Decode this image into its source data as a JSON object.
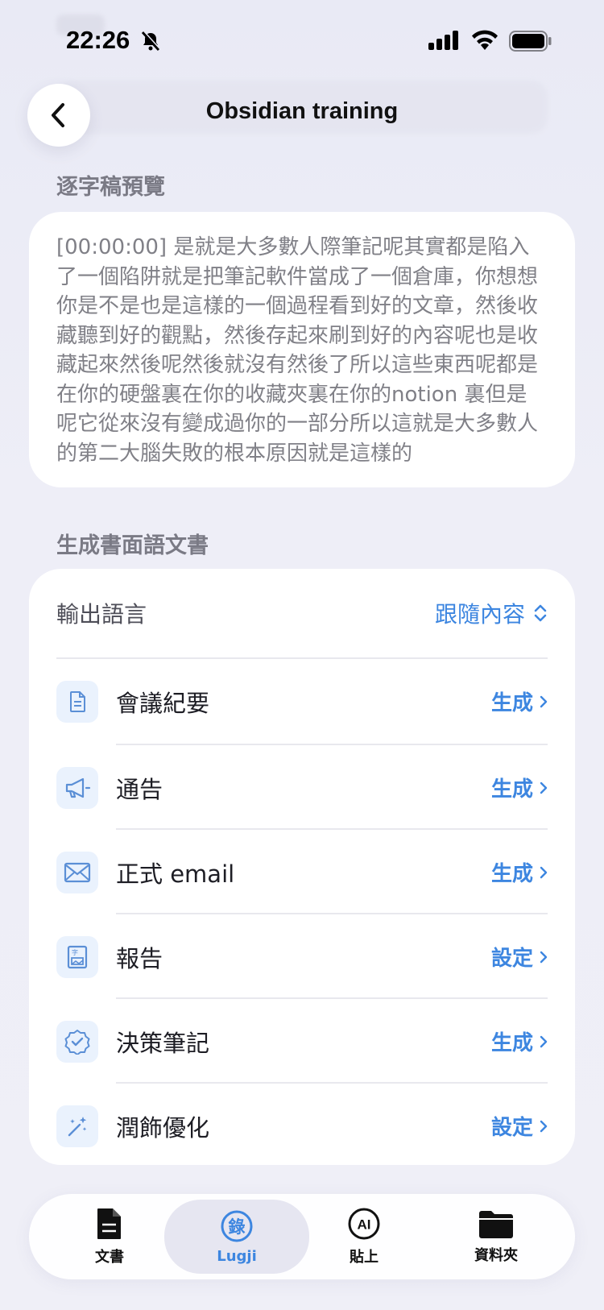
{
  "status": {
    "time": "22:26"
  },
  "nav": {
    "title": "Obsidian training"
  },
  "transcript": {
    "section_label": "逐字稿預覽",
    "text": "[00:00:00] 是就是大多數人際筆記呢其實都是陷入了一個陷阱就是把筆記軟件當成了一個倉庫，你想想你是不是也是這樣的一個過程看到好的文章，然後收藏聽到好的觀點，然後存起來刷到好的內容呢也是收藏起來然後呢然後就沒有然後了所以這些東西呢都是在你的硬盤裏在你的收藏夾裏在你的notion 裏但是呢它從來沒有變成過你的一部分所以這就是大多數人的第二大腦失敗的根本原因就是這樣的"
  },
  "documents": {
    "section_label": "生成書面語文書",
    "output_language": {
      "label": "輸出語言",
      "value": "跟隨內容"
    },
    "items": [
      {
        "label": "會議紀要",
        "action": "生成",
        "icon": "document-icon"
      },
      {
        "label": "通告",
        "action": "生成",
        "icon": "megaphone-icon"
      },
      {
        "label": "正式 email",
        "action": "生成",
        "icon": "envelope-icon"
      },
      {
        "label": "報告",
        "action": "設定",
        "icon": "report-icon"
      },
      {
        "label": "決策筆記",
        "action": "生成",
        "icon": "verified-badge-icon"
      },
      {
        "label": "潤飾優化",
        "action": "設定",
        "icon": "magic-wand-icon"
      }
    ]
  },
  "tabs": [
    {
      "label": "文書",
      "icon": "document-fill-icon"
    },
    {
      "label": "Lugji",
      "icon": "lugji-icon",
      "glyph": "錄",
      "active": true
    },
    {
      "label": "貼上",
      "icon": "ai-icon",
      "glyph": "AI"
    },
    {
      "label": "資料夾",
      "icon": "folder-icon"
    }
  ],
  "colors": {
    "accent": "#3d86e0",
    "background": "#eeeef7"
  }
}
